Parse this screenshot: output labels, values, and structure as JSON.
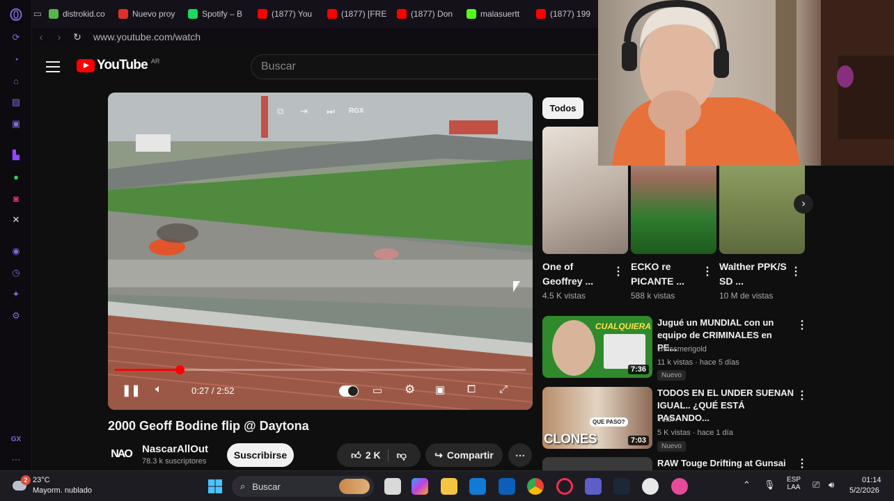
{
  "browser": {
    "tabs": [
      {
        "label": "distrokid.co",
        "color": "#55b848"
      },
      {
        "label": "Nuevo proy",
        "color": "#e0302a"
      },
      {
        "label": "Spotify – B",
        "color": "#1ed760"
      },
      {
        "label": "(1877) You",
        "color": "#ff0000"
      },
      {
        "label": "(1877) [FRE",
        "color": "#ff0000"
      },
      {
        "label": "(1877) Don",
        "color": "#ff0000"
      },
      {
        "label": "malasuertt",
        "color": "#53fc18"
      },
      {
        "label": "(1877) 199",
        "color": "#ff0000"
      }
    ],
    "url": "www.youtube.com/watch",
    "sidebar_footer": "GX"
  },
  "youtube": {
    "logo_text": "YouTube",
    "country": "AR",
    "search_placeholder": "Buscar",
    "player": {
      "time": "0:27 / 2:52",
      "progress": 0.157,
      "overlay_label": "RGX"
    },
    "video_title": "2000 Geoff Bodine flip @ Daytona",
    "channel": {
      "logo_text": "NAO",
      "name": "NascarAllOut",
      "subscribers": "78.3 k suscriptores",
      "subscribe_label": "Suscribirse"
    },
    "actions": {
      "likes": "2 K",
      "share_label": "Compartir"
    },
    "chip_label": "Todos",
    "shorts": [
      {
        "title": "One of Geoffrey ...",
        "views": "4.5 K vistas"
      },
      {
        "title": "ECKO re PICANTE ...",
        "views": "588 k vistas"
      },
      {
        "title": "Walther PPK/S SD ...",
        "views": "10 M de vistas"
      }
    ],
    "recommendations": [
      {
        "title": "Jugué un MUNDIAL con un equipo de CRIMINALES en PE...",
        "channel": "chrissmerigold",
        "meta": "11 k vistas · hace 5 días",
        "badge": "Nuevo",
        "duration": "7:36",
        "thumb_text": "CUALQUIERA"
      },
      {
        "title": "TODOS EN EL UNDER SUENAN IGUAL.. ¿QUÉ ESTÁ PASANDO...",
        "channel": "Yeibi",
        "meta": "5 K vistas · hace 1 día",
        "badge": "Nuevo",
        "duration": "7:03",
        "thumb_text": "CLONES",
        "thumb_sub": "QUE PASO?"
      },
      {
        "title": "RAW Touge Drifting at Gunsai"
      }
    ]
  },
  "taskbar": {
    "weather_temp": "23°C",
    "weather_desc": "Mayorm. nublado",
    "weather_badge": "2",
    "search_placeholder": "Buscar",
    "lang_top": "ESP",
    "lang_bottom": "LAA",
    "time": "01:14",
    "date": "5/2/2026"
  }
}
